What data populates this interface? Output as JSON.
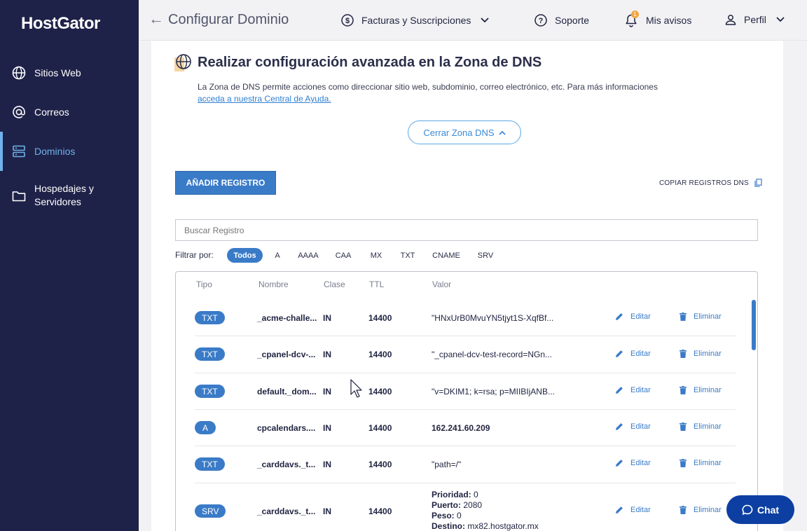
{
  "brand": {
    "logo": "HostGator"
  },
  "sidebar": {
    "items": [
      {
        "label": "Sitios Web",
        "icon": "globe-icon"
      },
      {
        "label": "Correos",
        "icon": "at-icon"
      },
      {
        "label": "Dominios",
        "icon": "server-icon",
        "active": true
      },
      {
        "label_line1": "Hospedajes y",
        "label_line2": "Servidores",
        "icon": "folder-icon"
      }
    ]
  },
  "topbar": {
    "title": "Configurar Dominio",
    "billing": "Facturas y Suscripciones",
    "support": "Soporte",
    "notices": "Mis avisos",
    "notices_count": "1",
    "profile": "Perfil"
  },
  "dns": {
    "title": "Realizar configuración avanzada en la Zona de DNS",
    "description": "La Zona de DNS permite acciones como direccionar sitio web, subdominio, correo electrónico, etc. Para más informaciones",
    "help_link": "acceda a nuestra Central de Ayuda.",
    "close_zone": "Cerrar Zona DNS",
    "add_record": "AÑADIR REGISTRO",
    "copy_records": "COPIAR REGISTROS DNS",
    "search_placeholder": "Buscar Registro",
    "filter_label": "Filtrar por:",
    "filters": [
      "Todos",
      "A",
      "AAAA",
      "CAA",
      "MX",
      "TXT",
      "CNAME",
      "SRV"
    ],
    "selected_filter": "Todos",
    "columns": [
      "Tipo",
      "Nombre",
      "Clase",
      "TTL",
      "Valor"
    ],
    "edit_label": "Editar",
    "delete_label": "Eliminar",
    "records": [
      {
        "type": "TXT",
        "name": "_acme-challe...",
        "class": "IN",
        "ttl": "14400",
        "value": "\"HNxUrB0MvuYN5tjyt1S-XqfBf..."
      },
      {
        "type": "TXT",
        "name": "_cpanel-dcv-...",
        "class": "IN",
        "ttl": "14400",
        "value": "\"_cpanel-dcv-test-record=NGn..."
      },
      {
        "type": "TXT",
        "name": "default._dom...",
        "class": "IN",
        "ttl": "14400",
        "value": "\"v=DKIM1; k=rsa; p=MIIBIjANB..."
      },
      {
        "type": "A",
        "name": "cpcalendars....",
        "class": "IN",
        "ttl": "14400",
        "value": "162.241.60.209"
      },
      {
        "type": "TXT",
        "name": "_carddavs._t...",
        "class": "IN",
        "ttl": "14400",
        "value": "\"path=/\""
      },
      {
        "type": "SRV",
        "name": "_carddavs._t...",
        "class": "IN",
        "ttl": "14400",
        "srv": {
          "priority_label": "Prioridad:",
          "priority": "0",
          "port_label": "Puerto:",
          "port": "2080",
          "weight_label": "Peso:",
          "weight": "0",
          "target_label": "Destino:",
          "target": "mx82.hostgator.mx"
        }
      }
    ]
  },
  "chat": {
    "label": "Chat"
  },
  "colors": {
    "sidebar": "#1f2248",
    "accent": "#3a7bc8",
    "active_nav": "#6fb2ec",
    "chat": "#0d3fa2"
  }
}
